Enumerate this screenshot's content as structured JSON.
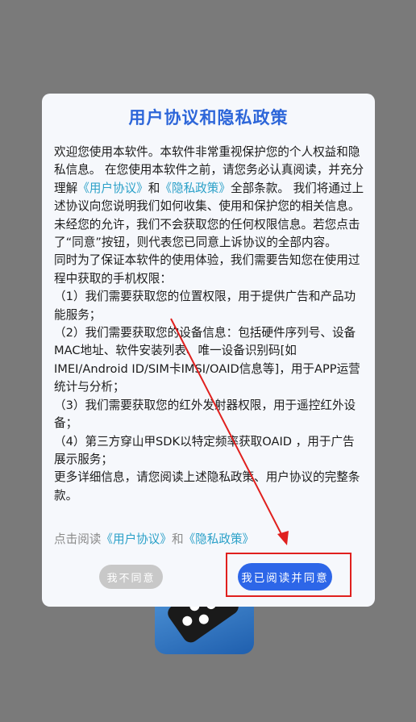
{
  "dialog": {
    "title": "用户协议和隐私政策",
    "intro_1": "欢迎您使用本软件。本软件非常重视保护您的个人权益和隐私信息。 在您使用本软件之前，请您务必认真阅读，并充分理解",
    "link_user_agreement": "《用户协议》",
    "and": "和",
    "link_privacy_policy": "《隐私政策》",
    "intro_2": "全部条款。 我们将通过上述协议向您说明我们如何收集、使用和保护您的相关信息。 未经您的允许，我们不会获取您的任何权限信息。若您点击了“同意”按钮，则代表您已同意上诉协议的全部内容。",
    "para_2": " 同时为了保证本软件的使用体验，我们需要告知您在使用过程中获取的手机权限：",
    "item_1": "（1）我们需要获取您的位置权限，用于提供广告和产品功能服务；",
    "item_2": "（2）我们需要获取您的设备信息：包括硬件序列号、设备MAC地址、软件安装列表、唯一设备识别码[如IMEI/Android ID/SIM卡IMSI/OAID信息等]，用于APP运营统计与分析；",
    "item_3": "（3）我们需要获取您的红外发射器权限，用于遥控红外设备；",
    "item_4": "（4）第三方穿山甲SDK以特定频率获取OAID ，用于广告展示服务；",
    "more_info": "更多详细信息，请您阅读上述隐私政策、用户协议的完整条款。",
    "read_prefix": "点击阅读",
    "disagree_label": "我不同意",
    "agree_label": "我已阅读并同意"
  },
  "colors": {
    "title": "#2d66d9",
    "link": "#2aa0c8",
    "agree_button": "#2d66e8",
    "disagree_button": "#c8c8c8",
    "annotation": "#e0201e",
    "backdrop": "#7a7a7a"
  }
}
